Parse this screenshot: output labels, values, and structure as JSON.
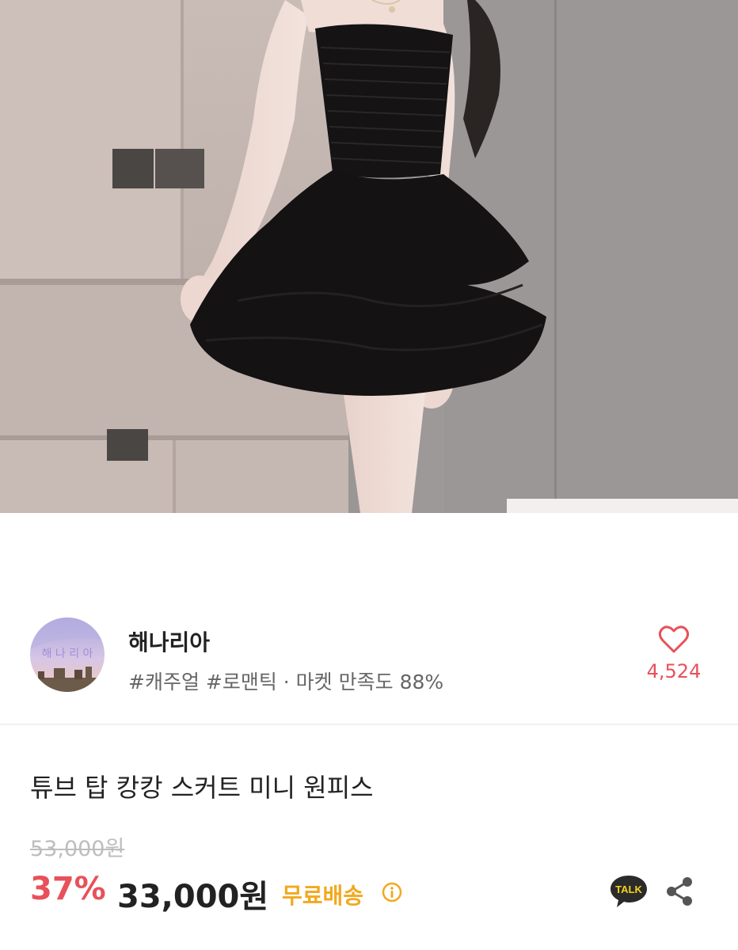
{
  "store": {
    "name": "해나리아",
    "avatar_text": "해 나 리 아",
    "tags": "#캐주얼 #로맨틱 · 마켓 만족도 88%",
    "likes": "4,524"
  },
  "product": {
    "title": "튜브 탑 캉캉 스커트 미니 원피스",
    "original_price": "53,000원",
    "discount": "37%",
    "price": "33,000원",
    "shipping": "무료배송"
  },
  "actions": {
    "talk_label": "TALK"
  },
  "colors": {
    "accent": "#e8515a",
    "shipping": "#f2a81e",
    "talk_bg": "#2b2b2b"
  },
  "icons": [
    "heart-icon",
    "info-icon",
    "kakao-talk-icon",
    "share-icon"
  ]
}
